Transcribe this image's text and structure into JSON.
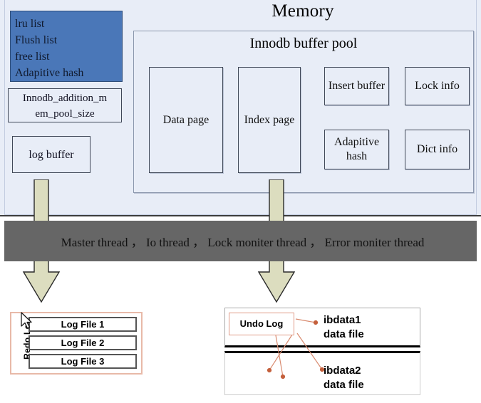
{
  "title": "Memory",
  "colors": {
    "memory_bg": "#e8edf7",
    "list_box_blue": "#4a77b8",
    "thread_bar_gray": "#666666",
    "arrow_fill": "#dcddbf",
    "undo_arrow": "#d98b70",
    "redo_border": "#e8b9a8"
  },
  "memory": {
    "title": "Memory",
    "list_box": {
      "lines": [
        "lru list",
        "Flush list",
        "free list",
        "Adapitive hash"
      ]
    },
    "mem_pool_box": {
      "line1": "Innodb_addition_m",
      "line2": "em_pool_size"
    },
    "log_buffer_box": {
      "label": "log buffer"
    },
    "buffer_pool": {
      "title": "Innodb buffer pool",
      "boxes": [
        {
          "label": "Data page"
        },
        {
          "label": "Index page"
        },
        {
          "label": "Insert buffer"
        },
        {
          "label": "Lock info"
        },
        {
          "label": "Adapitive hash"
        },
        {
          "label": "Dict info"
        }
      ]
    }
  },
  "thread_bar": {
    "label": "Master thread ，  Io thread  ，  Lock moniter thread  ，  Error moniter thread"
  },
  "redo_log": {
    "label": "Redo Log",
    "files": [
      {
        "label": "Log File 1"
      },
      {
        "label": "Log File 2"
      },
      {
        "label": "Log File 3"
      }
    ]
  },
  "ibdata": {
    "undo_log_label": "Undo Log",
    "panels": [
      {
        "label": "ibdata1\ndata file"
      },
      {
        "label": "ibdata2\ndata file"
      }
    ]
  }
}
